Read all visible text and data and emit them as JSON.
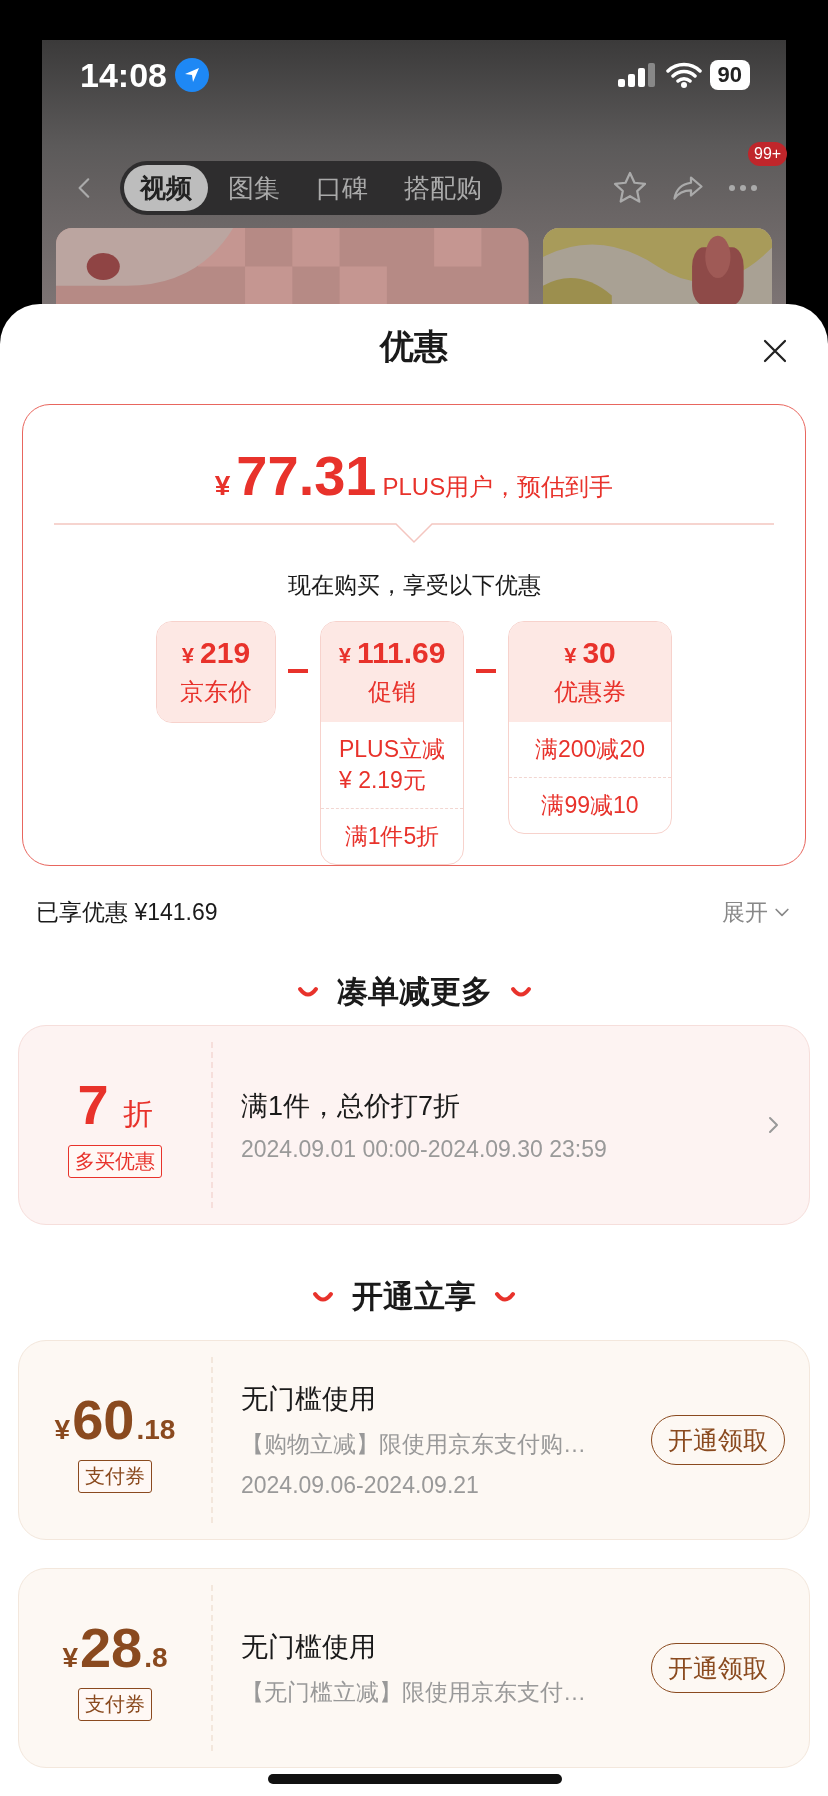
{
  "status_bar": {
    "time": "14:08",
    "battery": "90"
  },
  "nav": {
    "tabs": [
      {
        "label": "视频",
        "selected": true
      },
      {
        "label": "图集",
        "selected": false
      },
      {
        "label": "口碑",
        "selected": false
      },
      {
        "label": "搭配购",
        "selected": false
      }
    ],
    "badge": "99+"
  },
  "sheet": {
    "title": "优惠"
  },
  "price_card": {
    "currency": "¥",
    "price": "77.31",
    "caption": "PLUS用户，预估到手",
    "subtitle": "现在购买，享受以下优惠",
    "items": [
      {
        "amount": "219",
        "label": "京东价"
      },
      {
        "amount": "111.69",
        "label": "促销",
        "details": [
          [
            "PLUS立减",
            "¥ 2.19元"
          ],
          [
            "满1件5折"
          ]
        ]
      },
      {
        "amount": "30",
        "label": "优惠券",
        "details": [
          [
            "满200减20"
          ],
          [
            "满99减10"
          ]
        ]
      }
    ]
  },
  "saved": {
    "label": "已享优惠 ¥141.69",
    "toggle": "展开"
  },
  "sections": [
    {
      "title": "凑单减更多",
      "cards": [
        {
          "kind": "discount",
          "value": "7",
          "unit": "折",
          "tag": "多买优惠",
          "title": "满1件，总价打7折",
          "note": "2024.09.01 00:00-2024.09.30 23:59"
        }
      ]
    },
    {
      "title": "开通立享",
      "cards": [
        {
          "kind": "coupon",
          "currency": "¥",
          "value": "60",
          "unit": ".18",
          "tag": "支付券",
          "title": "无门槛使用",
          "desc": "【购物立减】限使用京东支付购…",
          "note": "2024.09.06-2024.09.21",
          "button": "开通领取"
        },
        {
          "kind": "coupon",
          "currency": "¥",
          "value": "28",
          "unit": ".8",
          "tag": "支付券",
          "title": "无门槛使用",
          "desc": "【无门槛立减】限使用京东支付…",
          "button": "开通领取"
        }
      ]
    }
  ]
}
